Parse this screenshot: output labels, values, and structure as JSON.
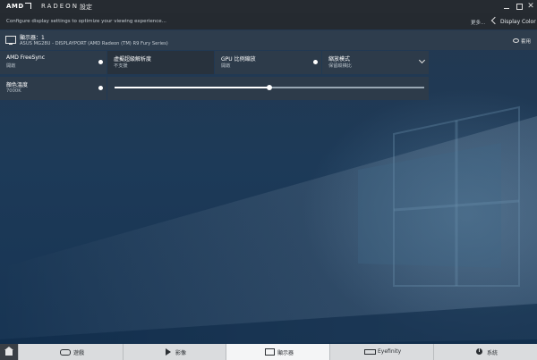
{
  "window": {
    "logo": "AMD",
    "brand": "RADEON",
    "page": "設定",
    "minimize": "",
    "maximize": "",
    "close": "✕"
  },
  "subbar": {
    "hint": "Configure display settings to optimize your viewing experience...",
    "more": "更多...",
    "display_color": "Display Color"
  },
  "display": {
    "title": "顯示器：1",
    "subtitle": "ASUS MG28U - DISPLAYPORT (AMD Radeon (TM) R9 Fury Series)",
    "apply": "套用"
  },
  "tiles": {
    "freesync": {
      "label": "AMD FreeSync",
      "value": "開啟"
    },
    "vsr": {
      "label": "虛擬超級解析度",
      "value": "不支援"
    },
    "gpu_scaling": {
      "label": "GPU 比例縮放",
      "value": "開啟"
    },
    "scaling_mode": {
      "label": "縮放模式",
      "value": "保留縱橫比"
    },
    "color_temp": {
      "label": "顏色溫度",
      "value": "7000K",
      "slider_fraction": 0.5
    }
  },
  "nav": {
    "home": "home",
    "games": "遊戲",
    "video": "影像",
    "display": "顯示器",
    "eyefinity": "Eyefinity",
    "system": "系統"
  }
}
